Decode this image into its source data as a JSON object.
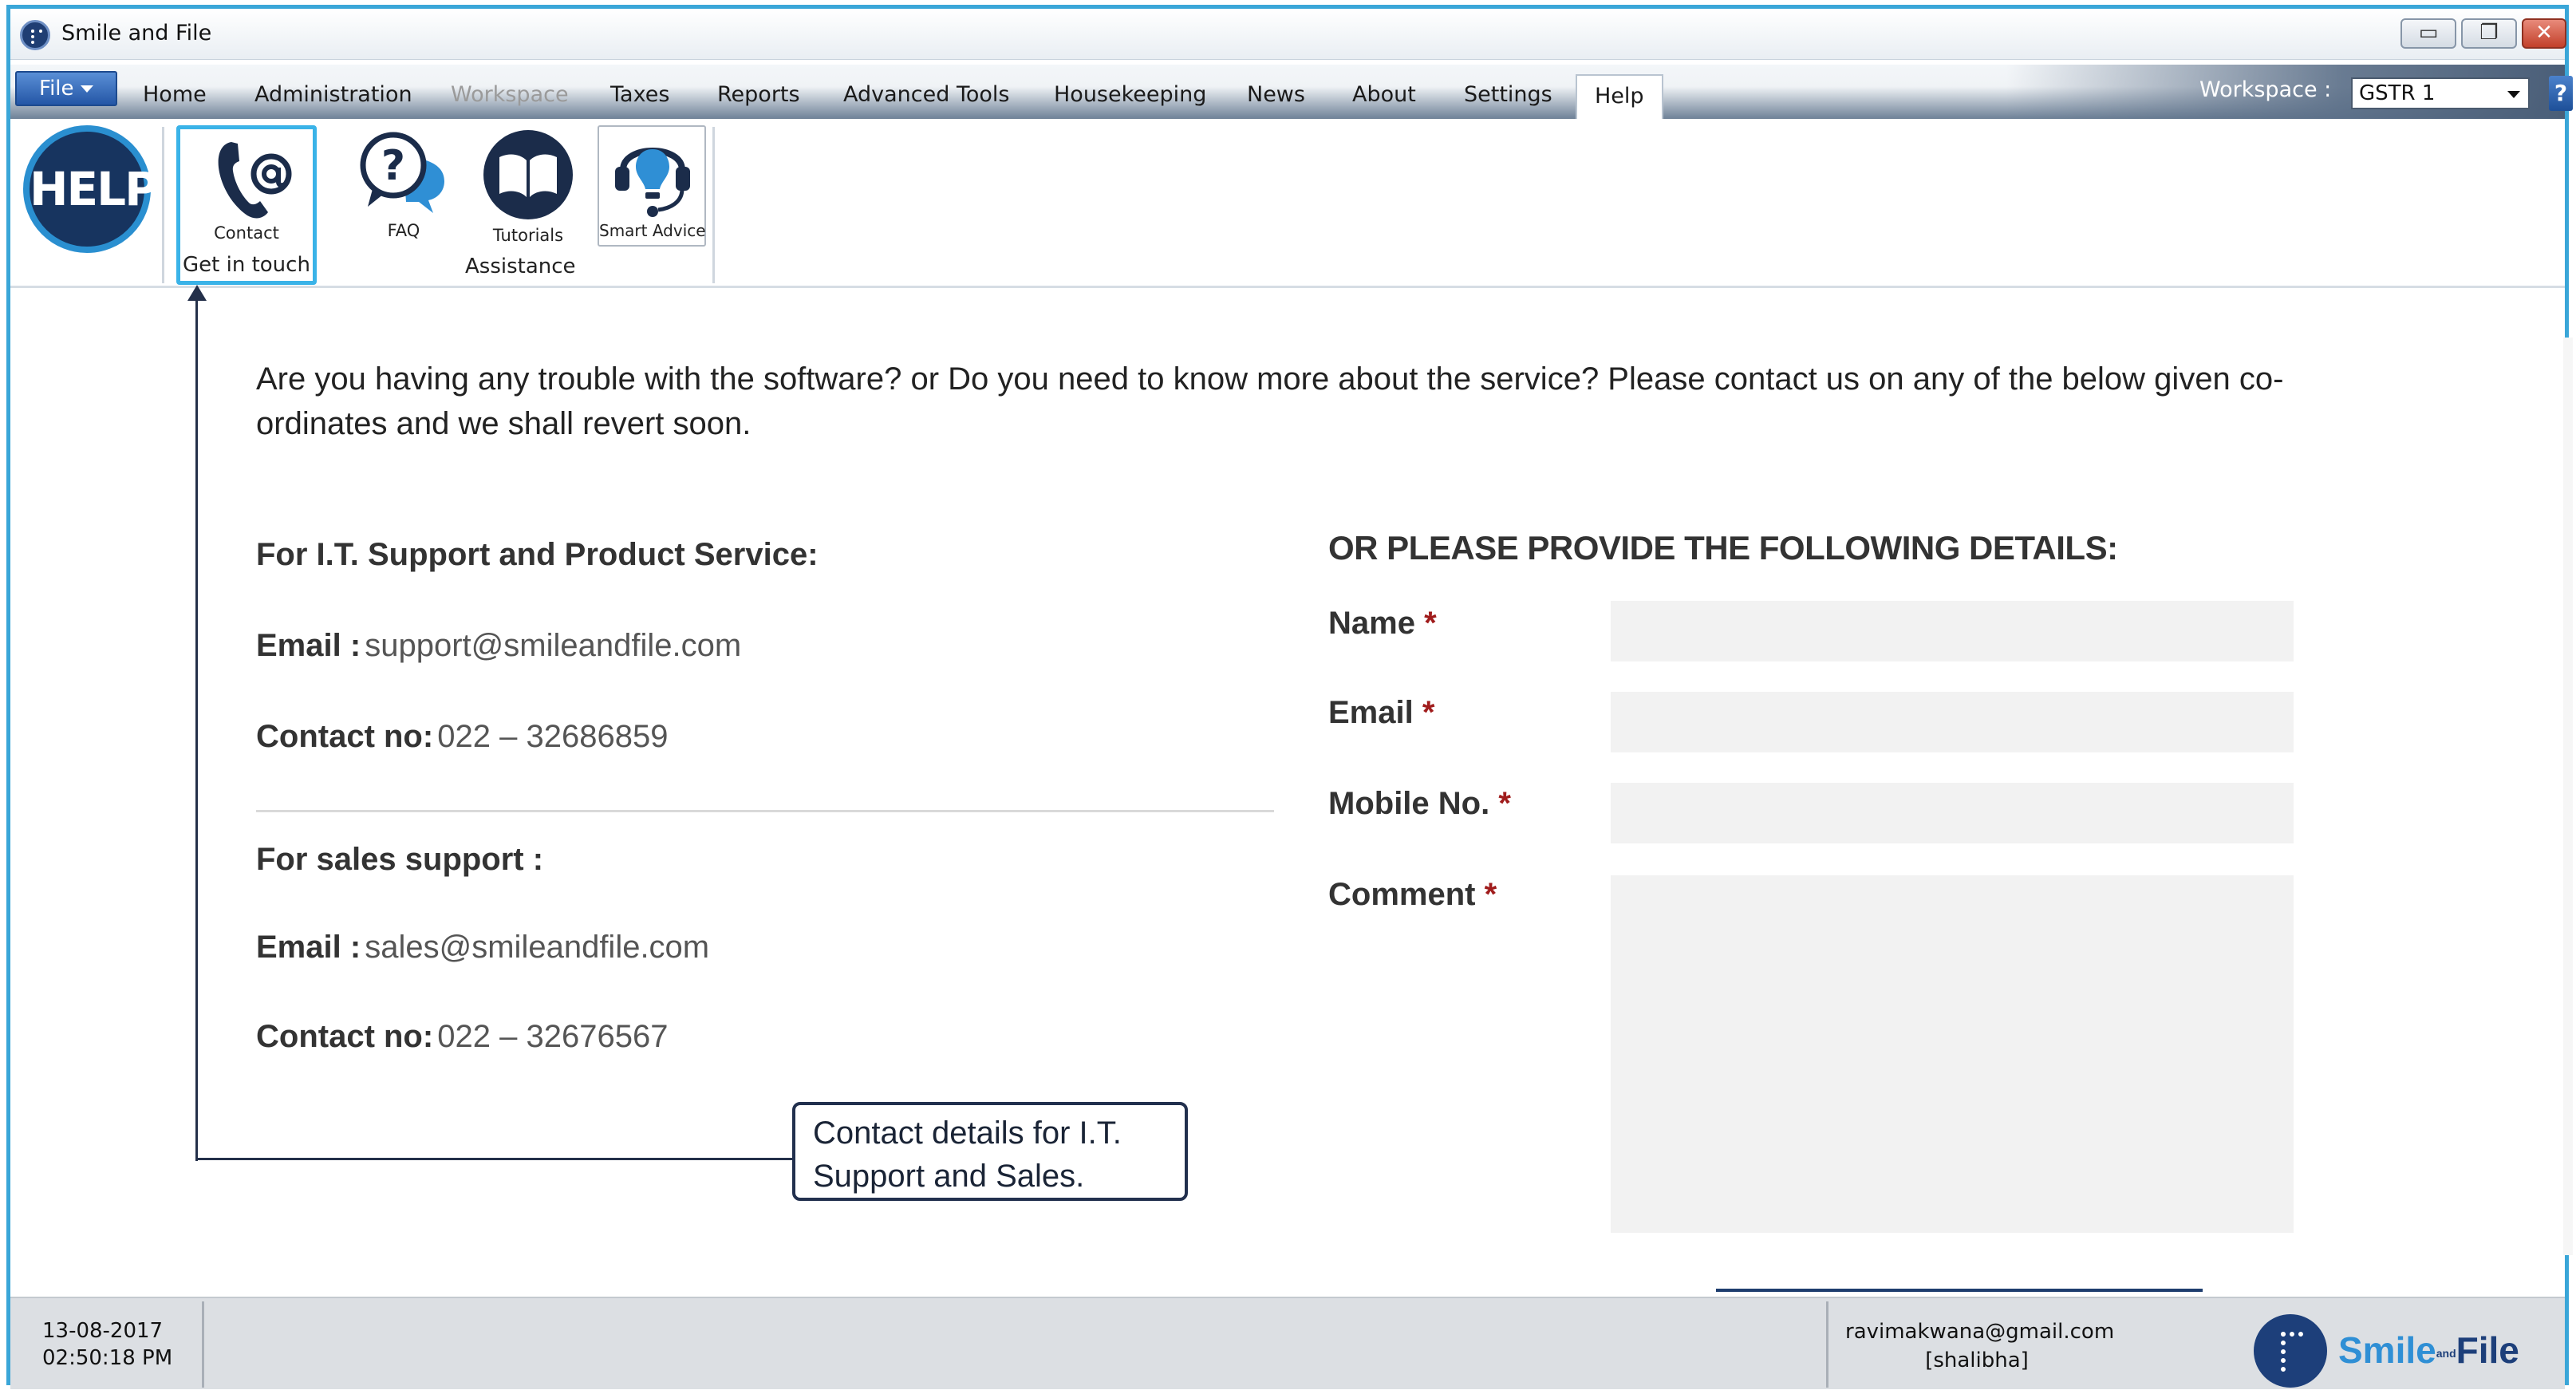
{
  "window": {
    "title": "Smile and File"
  },
  "window_controls": {
    "minimize": "▭",
    "restore": "❐",
    "close": "✕"
  },
  "menu": {
    "file_label": "File",
    "items": [
      "Home",
      "Administration",
      "Workspace",
      "Taxes",
      "Reports",
      "Advanced Tools",
      "Housekeeping",
      "News",
      "About",
      "Settings",
      "Help"
    ],
    "disabled_item": "Workspace",
    "active_item": "Help",
    "workspace_label": "Workspace :",
    "workspace_value": "GSTR 1",
    "help_button": "?"
  },
  "ribbon": {
    "logo_text": "HELP",
    "contact_label": "Contact",
    "faq_label": "FAQ",
    "tutorials_label": "Tutorials",
    "smart_advice_label": "Smart Advice",
    "group_get_in_touch": "Get in touch",
    "group_assistance": "Assistance",
    "accent_color": "#3ab3e8",
    "icons": [
      "phone-at-icon",
      "faq-chat-icon",
      "book-icon",
      "headset-bulb-icon"
    ]
  },
  "content": {
    "intro": "Are you having any trouble with the software? or Do you need to know more about the service? Please contact us on any of the below given co-ordinates and we shall revert soon.",
    "it_support_heading": "For I.T. Support and Product Service:",
    "it_email_label": "Email :",
    "it_email_value": "support@smileandfile.com",
    "it_contact_label": "Contact no:",
    "it_contact_value": "022 – 32686859",
    "sales_heading": "For sales support :",
    "sales_email_label": "Email :",
    "sales_email_value": "sales@smileandfile.com",
    "sales_contact_label": "Contact no:",
    "sales_contact_value": "022 – 32676567"
  },
  "form": {
    "title": "OR PLEASE PROVIDE THE FOLLOWING DETAILS:",
    "name_label": "Name",
    "email_label": "Email",
    "mobile_label": "Mobile No.",
    "comment_label": "Comment",
    "required_mark": "*",
    "name_value": "",
    "email_value": "",
    "mobile_value": "",
    "comment_value": ""
  },
  "callout": {
    "text": "Contact details for I.T. Support and Sales."
  },
  "status": {
    "date": "13-08-2017",
    "time": "02:50:18 PM",
    "user_email": "ravimakwana@gmail.com",
    "user_name": "[shalibha]",
    "brand_smile": "Smile",
    "brand_and": "and",
    "brand_file": "File"
  }
}
